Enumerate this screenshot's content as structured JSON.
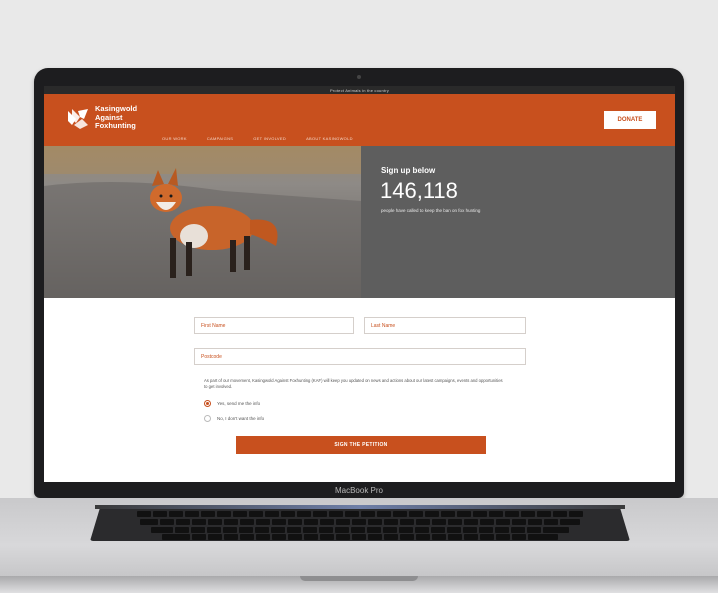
{
  "site": {
    "announcement": "Protect Animals in the country",
    "logo_lines": [
      "Kasingwold",
      "Against",
      "Foxhunting"
    ],
    "nav": [
      "OUR WORK",
      "CAMPAIGNS",
      "GET INVOLVED",
      "ABOUT KASINGWOLD"
    ],
    "donate_label": "DONATE",
    "brand_color": "#c8501e"
  },
  "hero": {
    "heading": "Sign up below",
    "count": "146,118",
    "subtext": "people have called to keep the ban on fox hunting"
  },
  "form": {
    "first_name_placeholder": "First Name",
    "last_name_placeholder": "Last Name",
    "postcode_placeholder": "Postcode",
    "consent_text": "As part of our movement, Kasingwold Against Foxhunting (KAF) will keep you updated on news and actions about our latest campaigns, events and opportunities to get involved.",
    "options": [
      {
        "label": "Yes, send me the info",
        "checked": true
      },
      {
        "label": "No, I don't want the info",
        "checked": false
      }
    ],
    "submit_label": "SIGN THE PETITION"
  },
  "device": {
    "label": "MacBook Pro"
  }
}
